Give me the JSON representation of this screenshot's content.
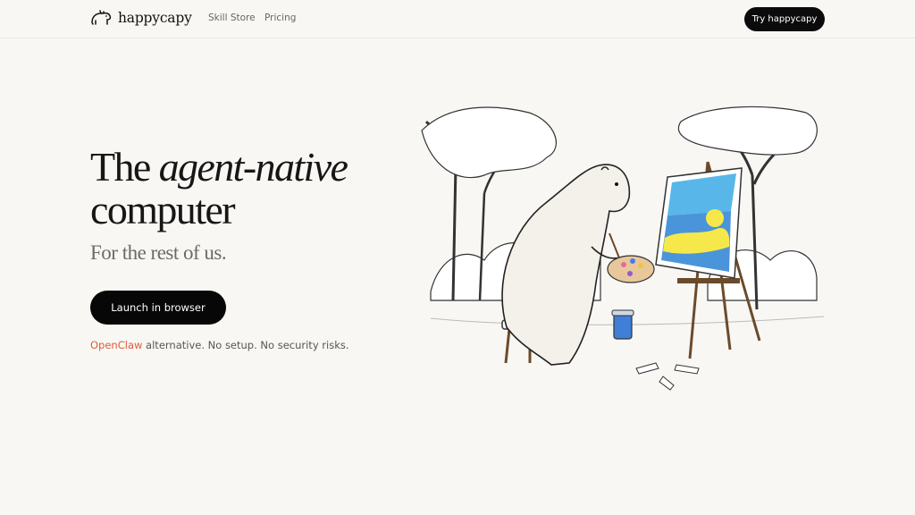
{
  "nav": {
    "brand": "happycapy",
    "links": [
      "Skill Store",
      "Pricing"
    ],
    "cta_label": "Try happycapy"
  },
  "hero": {
    "title_prefix": "The ",
    "title_emphasis": "agent-native",
    "title_suffix": "computer",
    "subtitle": "For the rest of us.",
    "primary_button": "Launch in browser",
    "tagline_link": "OpenClaw",
    "tagline_rest": " alternative. No setup. No security risks."
  },
  "colors": {
    "background": "#f9f7f3",
    "button": "#0b0b0b",
    "accent_link": "#e05a3a"
  },
  "icons": [
    "capybara-logo-icon"
  ],
  "illustration": "capybara-painting-illustration"
}
